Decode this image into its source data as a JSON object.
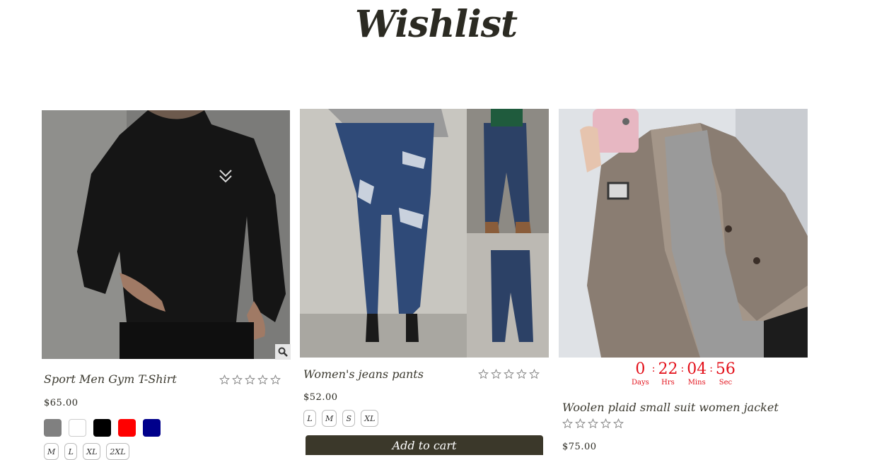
{
  "page": {
    "title": "Wishlist"
  },
  "products": [
    {
      "name": "Sport Men Gym T-Shirt",
      "price": "$65.00",
      "rating": 0,
      "colors": [
        "#808080",
        "#ffffff",
        "#000000",
        "#ff0000",
        "#00008b"
      ],
      "sizes": [
        "M",
        "L",
        "XL",
        "2XL"
      ],
      "zoom_icon": "magnifier-icon"
    },
    {
      "name": "Women's jeans pants",
      "price": "$52.00",
      "rating": 0,
      "sizes": [
        "L",
        "M",
        "S",
        "XL"
      ],
      "add_to_cart_label": "Add to cart"
    },
    {
      "name": "Woolen plaid small suit women jacket",
      "price": "$75.00",
      "rating": 0,
      "countdown": {
        "days": "0",
        "hours": "22",
        "minutes": "04",
        "seconds": "56",
        "days_label": "Days",
        "hours_label": "Hrs",
        "minutes_label": "Mins",
        "seconds_label": "Sec"
      }
    }
  ]
}
